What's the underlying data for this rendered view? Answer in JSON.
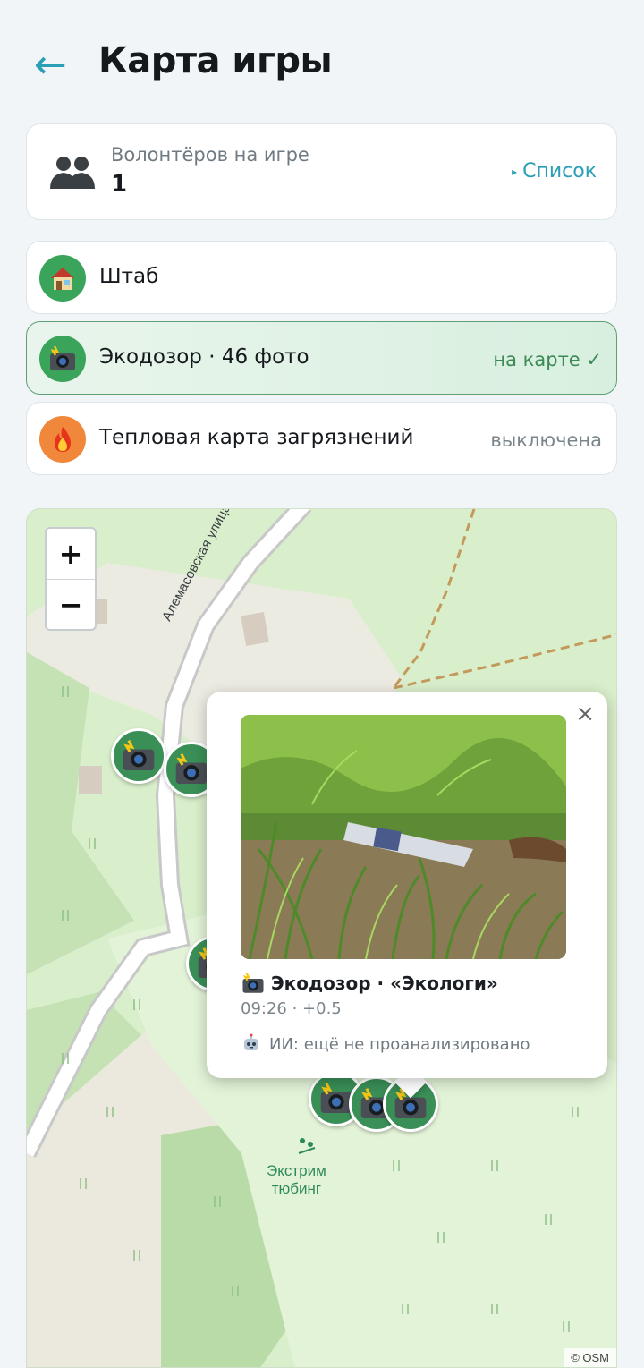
{
  "header": {
    "back_icon": "arrow-left-icon",
    "title": "Карта игры"
  },
  "volunteers": {
    "label": "Волонтёров на игре",
    "count": "1",
    "list_link": "Список",
    "icon": "people-icon"
  },
  "layers": [
    {
      "icon": "house-icon",
      "label": "Штаб",
      "status": ""
    },
    {
      "icon": "camera-flash-icon",
      "label": "Экодозор · 46 фото",
      "status": "на карте ✓"
    },
    {
      "icon": "fire-icon",
      "label": "Тепловая карта загрязнений",
      "status": "выключена"
    }
  ],
  "map": {
    "zoom_in": "+",
    "zoom_out": "−",
    "street_label": "Алемасовская улица",
    "poi_label_line1": "Экстрим",
    "poi_label_line2": "тюбинг",
    "attribution": "© OSM",
    "colors": {
      "forest": "#c6e4b7",
      "grass": "#d8eecb",
      "light_zone": "#e6f4dc",
      "road": "#ffffff",
      "marker": "#3a8f57"
    }
  },
  "popup": {
    "close": "×",
    "title": "Экодозор · «Экологи»",
    "meta": "09:26 · +0.5",
    "ai_status": "ИИ: ещё не проанализировано",
    "photo_icon": "trash-photo",
    "robot_icon": "robot-icon"
  }
}
